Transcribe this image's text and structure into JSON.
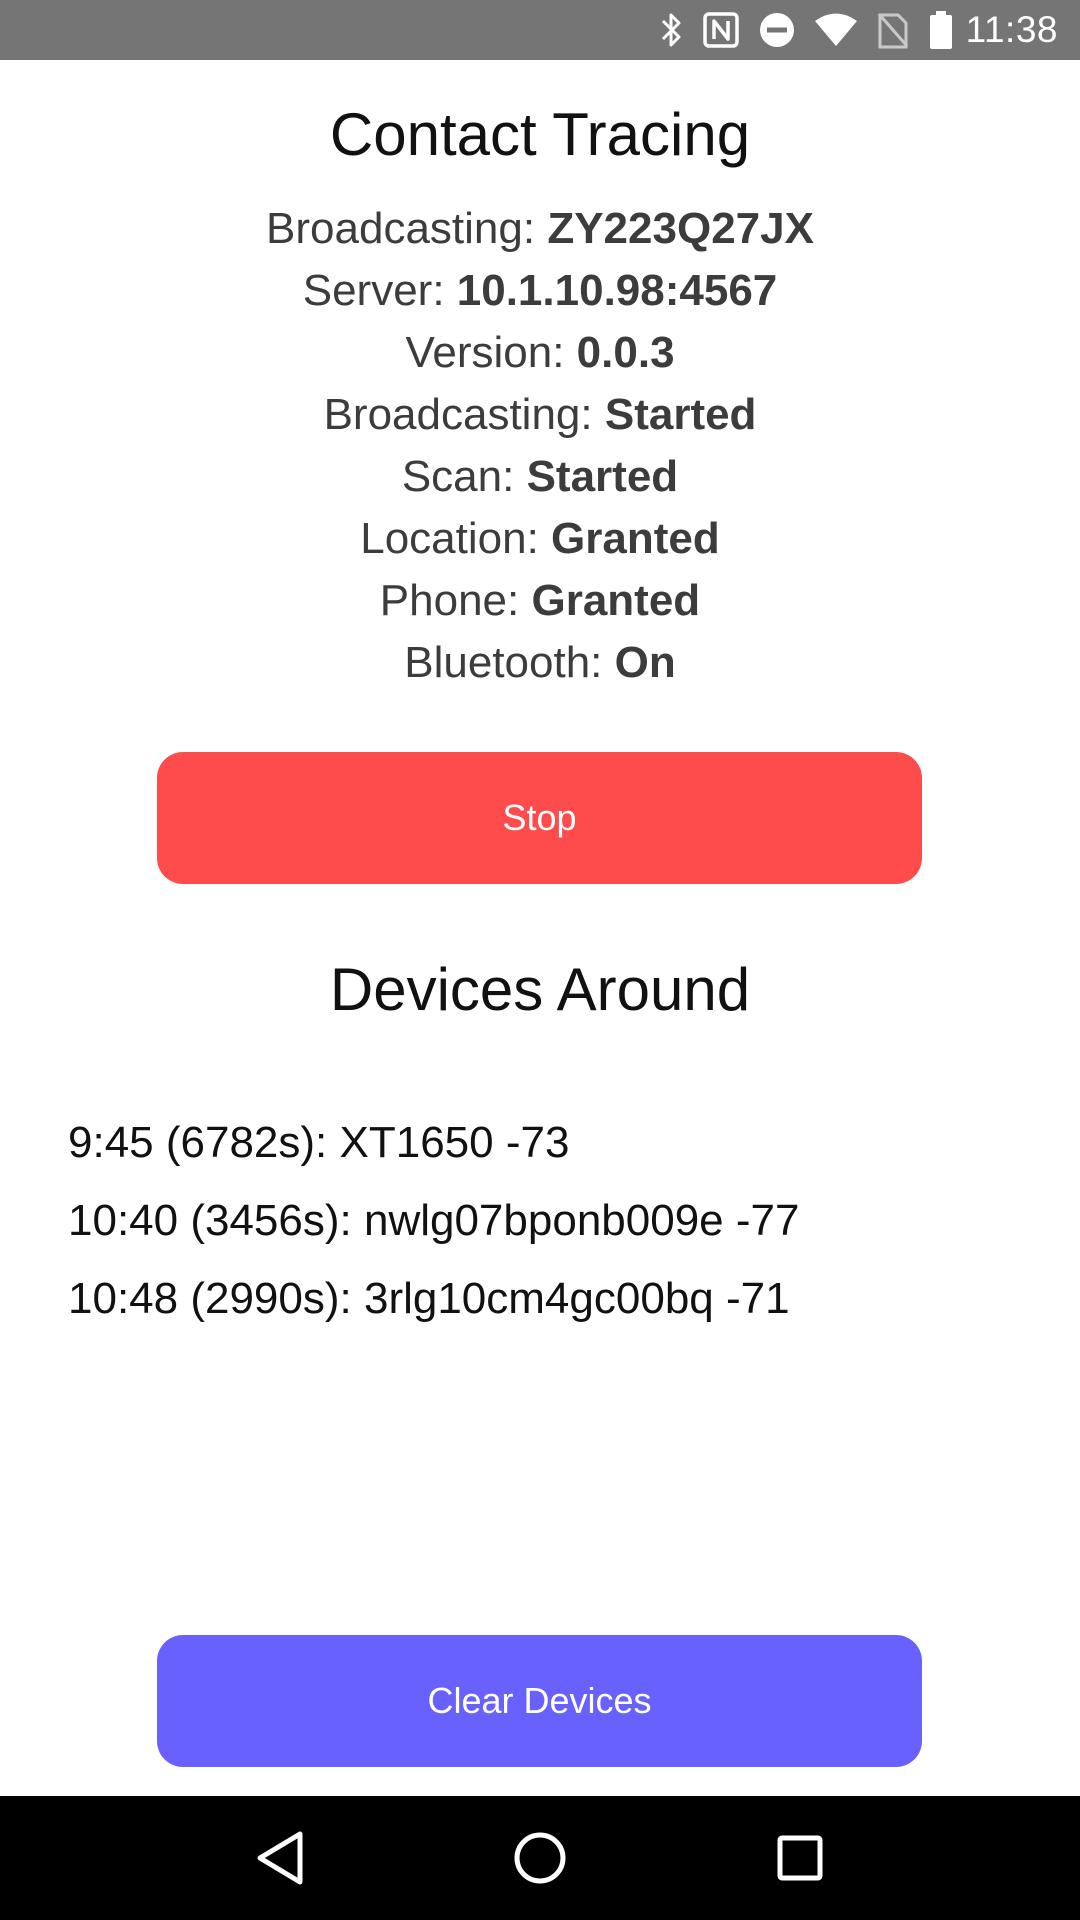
{
  "status_bar": {
    "time": "11:38",
    "icons": [
      "bluetooth-icon",
      "nfc-icon",
      "do-not-disturb-icon",
      "wifi-icon",
      "no-sim-icon",
      "battery-icon"
    ]
  },
  "app": {
    "title": "Contact Tracing",
    "info": [
      {
        "label": "Broadcasting: ",
        "value": "ZY223Q27JX"
      },
      {
        "label": "Server: ",
        "value": "10.1.10.98:4567"
      },
      {
        "label": "Version: ",
        "value": "0.0.3"
      },
      {
        "label": "Broadcasting: ",
        "value": "Started"
      },
      {
        "label": "Scan: ",
        "value": "Started"
      },
      {
        "label": "Location: ",
        "value": "Granted"
      },
      {
        "label": "Phone: ",
        "value": "Granted"
      },
      {
        "label": "Bluetooth: ",
        "value": "On"
      }
    ],
    "stop_button": {
      "label": "Stop",
      "color": "#fe4b4b"
    },
    "devices_title": "Devices Around",
    "devices": [
      "9:45 (6782s): XT1650 -73",
      "10:40 (3456s): nwlg07bponb009e -77",
      "10:48 (2990s): 3rlg10cm4gc00bq -71"
    ],
    "clear_button": {
      "label": "Clear Devices",
      "color": "#6961fd"
    }
  },
  "nav_bar": {
    "icons": [
      "back-icon",
      "home-icon",
      "recents-icon"
    ]
  }
}
